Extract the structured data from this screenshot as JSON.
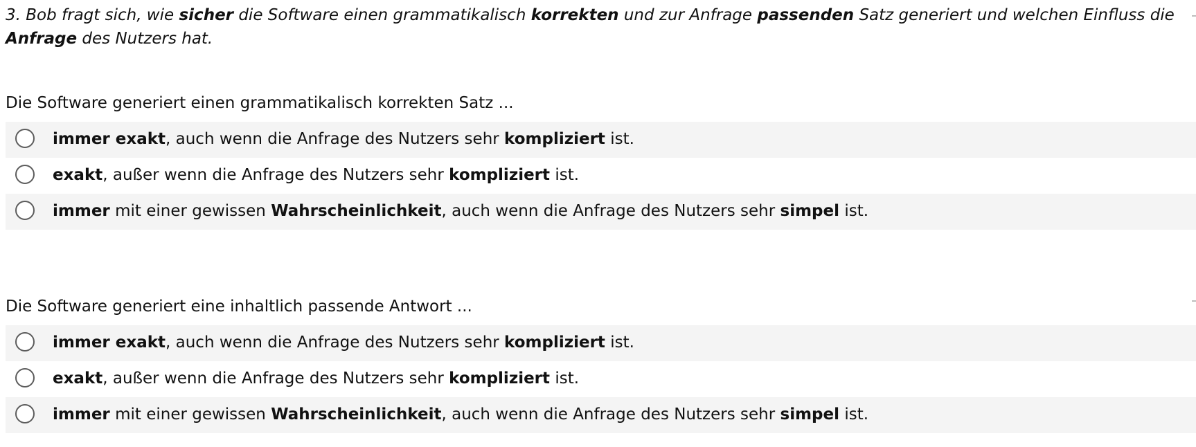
{
  "question": {
    "segments": [
      {
        "text": "3. Bob fragt sich, wie ",
        "bold": false
      },
      {
        "text": "sicher",
        "bold": true
      },
      {
        "text": " die Software einen grammatikalisch ",
        "bold": false
      },
      {
        "text": "korrekten",
        "bold": true
      },
      {
        "text": " und zur Anfrage ",
        "bold": false
      },
      {
        "text": "passenden",
        "bold": true
      },
      {
        "text": " Satz generiert und welchen Einfluss die ",
        "bold": false
      },
      {
        "text": "Anfrage",
        "bold": true
      },
      {
        "text": " des Nutzers hat.",
        "bold": false
      }
    ]
  },
  "sections": [
    {
      "intro": "Die Software generiert einen grammatikalisch korrekten Satz ...",
      "options": [
        {
          "selected": false,
          "segments": [
            {
              "text": "immer exakt",
              "bold": true
            },
            {
              "text": ", auch wenn die Anfrage des Nutzers sehr ",
              "bold": false
            },
            {
              "text": "kompliziert",
              "bold": true
            },
            {
              "text": " ist.",
              "bold": false
            }
          ]
        },
        {
          "selected": false,
          "segments": [
            {
              "text": "exakt",
              "bold": true
            },
            {
              "text": ", außer wenn die Anfrage des Nutzers sehr ",
              "bold": false
            },
            {
              "text": "kompliziert",
              "bold": true
            },
            {
              "text": " ist.",
              "bold": false
            }
          ]
        },
        {
          "selected": false,
          "segments": [
            {
              "text": "immer",
              "bold": true
            },
            {
              "text": " mit einer gewissen ",
              "bold": false
            },
            {
              "text": "Wahrscheinlichkeit",
              "bold": true
            },
            {
              "text": ", auch wenn die Anfrage des Nutzers sehr ",
              "bold": false
            },
            {
              "text": "simpel",
              "bold": true
            },
            {
              "text": " ist.",
              "bold": false
            }
          ]
        }
      ]
    },
    {
      "intro": "Die Software generiert eine inhaltlich passende Antwort ...",
      "options": [
        {
          "selected": false,
          "segments": [
            {
              "text": "immer exakt",
              "bold": true
            },
            {
              "text": ", auch wenn die Anfrage des Nutzers sehr ",
              "bold": false
            },
            {
              "text": "kompliziert",
              "bold": true
            },
            {
              "text": " ist.",
              "bold": false
            }
          ]
        },
        {
          "selected": false,
          "segments": [
            {
              "text": "exakt",
              "bold": true
            },
            {
              "text": ", außer wenn die Anfrage des Nutzers sehr ",
              "bold": false
            },
            {
              "text": "kompliziert",
              "bold": true
            },
            {
              "text": " ist.",
              "bold": false
            }
          ]
        },
        {
          "selected": false,
          "segments": [
            {
              "text": "immer",
              "bold": true
            },
            {
              "text": " mit einer gewissen ",
              "bold": false
            },
            {
              "text": "Wahrscheinlichkeit",
              "bold": true
            },
            {
              "text": ", auch wenn die Anfrage des Nutzers sehr ",
              "bold": false
            },
            {
              "text": "simpel",
              "bold": true
            },
            {
              "text": " ist.",
              "bold": false
            }
          ]
        }
      ]
    }
  ],
  "colors": {
    "row_shade": "#f4f4f4",
    "radio_border": "#5c5c5c",
    "text": "#111111"
  }
}
